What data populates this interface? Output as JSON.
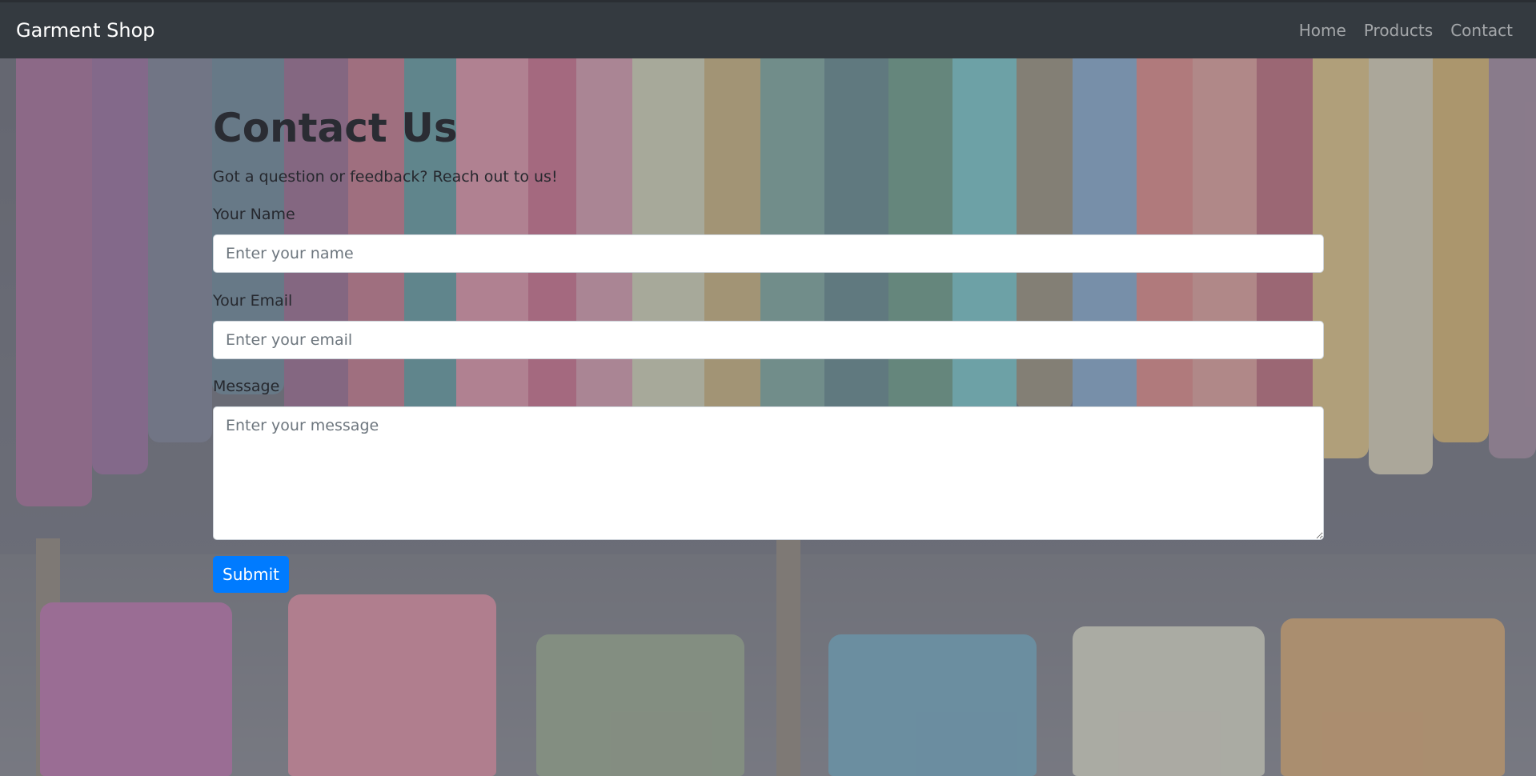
{
  "navbar": {
    "brand": "Garment Shop",
    "links": [
      {
        "label": "Home"
      },
      {
        "label": "Products"
      },
      {
        "label": "Contact"
      }
    ]
  },
  "contact": {
    "title": "Contact Us",
    "subtitle": "Got a question or feedback? Reach out to us!",
    "name_label": "Your Name",
    "name_placeholder": "Enter your name",
    "email_label": "Your Email",
    "email_placeholder": "Enter your email",
    "message_label": "Message",
    "message_placeholder": "Enter your message",
    "submit_label": "Submit"
  },
  "colors": {
    "navbar_bg": "#343a40",
    "primary_button": "#007bff"
  }
}
